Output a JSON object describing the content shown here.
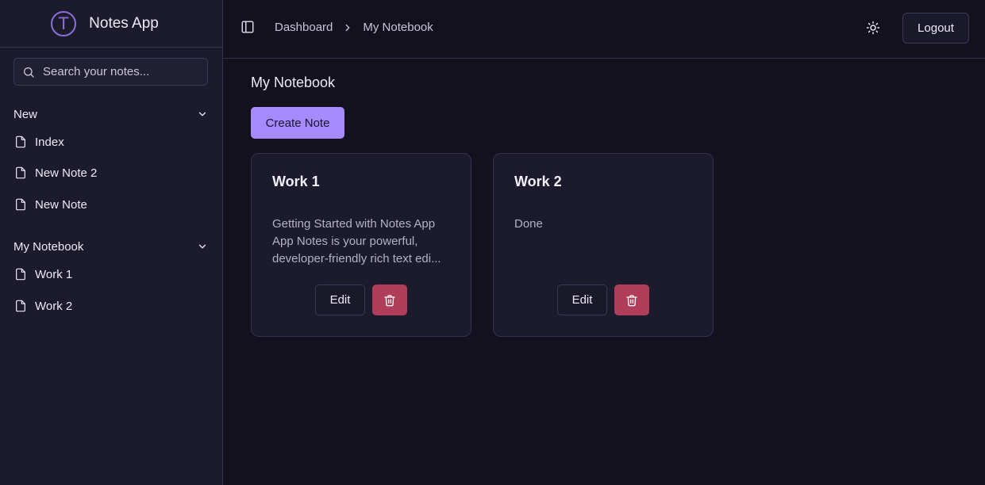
{
  "app": {
    "title": "Notes App",
    "logo_letter": "T"
  },
  "search": {
    "placeholder": "Search your notes..."
  },
  "sidebar": {
    "groups": [
      {
        "label": "New",
        "items": [
          {
            "label": "Index"
          },
          {
            "label": "New Note 2"
          },
          {
            "label": "New Note"
          }
        ]
      },
      {
        "label": "My Notebook",
        "items": [
          {
            "label": "Work 1"
          },
          {
            "label": "Work 2"
          }
        ]
      }
    ]
  },
  "header": {
    "breadcrumb": [
      "Dashboard",
      "My Notebook"
    ],
    "logout_label": "Logout"
  },
  "main": {
    "title": "My Notebook",
    "create_label": "Create Note",
    "cards": [
      {
        "title": "Work 1",
        "body_lines": [
          "Getting Started with Notes App",
          "App Notes is your powerful,",
          "developer-friendly rich text edi..."
        ],
        "edit_label": "Edit"
      },
      {
        "title": "Work 2",
        "body_lines": [
          "Done"
        ],
        "edit_label": "Edit"
      }
    ]
  },
  "colors": {
    "accent": "#a48afa",
    "danger": "#b03d59",
    "background": "#12111d",
    "sidebar": "#1c1b2e"
  },
  "icons": {
    "logo": "logo-circle-icon",
    "search": "search-icon",
    "chevron": "chevron-down-icon",
    "file": "file-icon",
    "sidebar_toggle": "sidebar-toggle-icon",
    "breadcrumb_separator": "chevron-right-icon",
    "theme": "sun-icon",
    "delete": "trash-icon"
  }
}
